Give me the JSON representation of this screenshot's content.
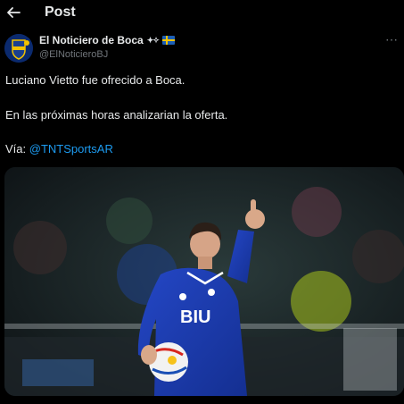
{
  "header": {
    "back_icon": "arrow-left-icon",
    "title": "Post"
  },
  "author": {
    "name": "El Noticiero de Boca",
    "handle": "@ElNoticieroBJ",
    "badges": [
      "sparkle-stars-icon",
      "sweden-flag-icon"
    ]
  },
  "tweet": {
    "line1": "Luciano Vietto fue ofrecido a Boca.",
    "line2": "En las próximas horas analizarian la oferta.",
    "via_prefix": "Vía: ",
    "via_mention": "@TNTSportsAR"
  },
  "media": {
    "jersey_text": "BIU",
    "description_icon": "photo-player-thumbs-up"
  },
  "colors": {
    "background": "#000000",
    "text": "#e7e9ea",
    "muted": "#71767b",
    "link": "#1d9bf0",
    "jersey": "#1a3fb0"
  }
}
